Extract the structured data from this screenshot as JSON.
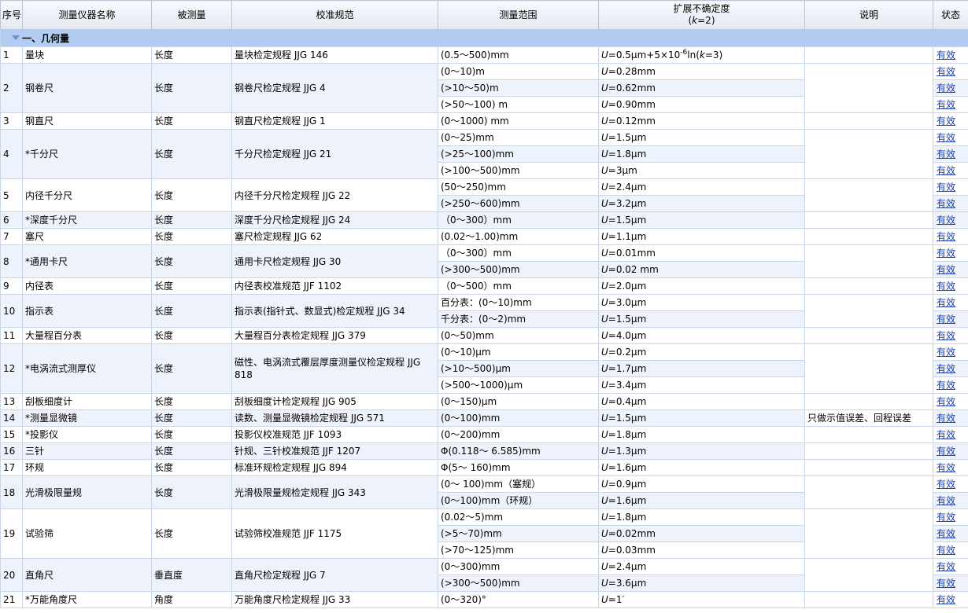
{
  "header": {
    "col_no": "序号",
    "col_name": "测量仪器名称",
    "col_measurand": "被测量",
    "col_spec": "校准规范",
    "col_range": "测量范围",
    "col_uncert_line1": "扩展不确定度",
    "col_uncert_line2_pre": "(",
    "col_uncert_k": "k",
    "col_uncert_line2_post": "=2)",
    "col_note": "说明",
    "col_status": "状态"
  },
  "group": {
    "label": "一、几何量"
  },
  "status_label": "有效",
  "uncertainty_symbol": "U",
  "rows": [
    {
      "no": "1",
      "name": "量块",
      "measurand": "长度",
      "spec": "量块检定规程 JJG 146",
      "note": "",
      "subs": [
        {
          "range": "(0.5～500)mm",
          "u_pre": "=0.5µm+5×10",
          "u_exp": "-6",
          "u_mid": "ln(",
          "u_k": "k",
          "u_post": "=3)"
        }
      ]
    },
    {
      "no": "2",
      "name": "钢卷尺",
      "measurand": "长度",
      "spec": "钢卷尺检定规程 JJG 4",
      "note": "",
      "subs": [
        {
          "range": "(0～10)m",
          "u": "=0.28mm"
        },
        {
          "range": "(>10～50)m",
          "u": "=0.62mm"
        },
        {
          "range": "(>50～100) m",
          "u": "=0.90mm"
        }
      ]
    },
    {
      "no": "3",
      "name": "钢直尺",
      "measurand": "长度",
      "spec": "钢直尺检定规程 JJG 1",
      "note": "",
      "subs": [
        {
          "range": "(0～1000) mm",
          "u": "=0.12mm"
        }
      ]
    },
    {
      "no": "4",
      "name": "*千分尺",
      "measurand": "长度",
      "spec": "千分尺检定规程 JJG 21",
      "note": "",
      "subs": [
        {
          "range": "(0～25)mm",
          "u": "=1.5µm"
        },
        {
          "range": "(>25～100)mm",
          "u": "=1.8µm"
        },
        {
          "range": "(>100～500)mm",
          "u": "=3µm"
        }
      ]
    },
    {
      "no": "5",
      "name": "内径千分尺",
      "measurand": "长度",
      "spec": "内径千分尺检定规程 JJG 22",
      "note": "",
      "subs": [
        {
          "range": "(50～250)mm",
          "u": "=2.4µm"
        },
        {
          "range": "(>250～600)mm",
          "u": "=3.2µm"
        }
      ]
    },
    {
      "no": "6",
      "name": "*深度千分尺",
      "measurand": "长度",
      "spec": "深度千分尺检定规程 JJG 24",
      "note": "",
      "subs": [
        {
          "range": "（0～300）mm",
          "u": "=1.5µm"
        }
      ]
    },
    {
      "no": "7",
      "name": "塞尺",
      "measurand": "长度",
      "spec": "塞尺检定规程 JJG 62",
      "note": "",
      "subs": [
        {
          "range": "(0.02～1.00)mm",
          "u": "=1.1µm"
        }
      ]
    },
    {
      "no": "8",
      "name": "*通用卡尺",
      "measurand": "长度",
      "spec": "通用卡尺检定规程 JJG 30",
      "note": "",
      "subs": [
        {
          "range": "（0～300）mm",
          "u": "=0.01mm"
        },
        {
          "range": "(>300～500)mm",
          "u": "=0.02 mm"
        }
      ]
    },
    {
      "no": "9",
      "name": "内径表",
      "measurand": "长度",
      "spec": "内径表校准规范 JJF 1102",
      "note": "",
      "subs": [
        {
          "range": "（0～500）mm",
          "u": "=2.0µm"
        }
      ]
    },
    {
      "no": "10",
      "name": "指示表",
      "measurand": "长度",
      "spec": "指示表(指针式、数显式)检定规程 JJG 34",
      "note": "",
      "subs": [
        {
          "range": "百分表：(0～10)mm",
          "u": "=3.0µm"
        },
        {
          "range": "千分表：(0～2)mm",
          "u": "=1.5µm"
        }
      ]
    },
    {
      "no": "11",
      "name": "大量程百分表",
      "measurand": "长度",
      "spec": "大量程百分表检定规程 JJG 379",
      "note": "",
      "subs": [
        {
          "range": "(0～50)mm",
          "u": "=4.0µm"
        }
      ]
    },
    {
      "no": "12",
      "name": "*电涡流式测厚仪",
      "measurand": "长度",
      "spec": "磁性、电涡流式覆层厚度测量仪检定规程 JJG 818",
      "note": "",
      "subs": [
        {
          "range": "(0～10)µm",
          "u": "=0.2µm"
        },
        {
          "range": "(>10～500)µm",
          "u": "=1.7µm"
        },
        {
          "range": "(>500～1000)µm",
          "u": "=3.4µm"
        }
      ]
    },
    {
      "no": "13",
      "name": "刮板细度计",
      "measurand": "长度",
      "spec": "刮板细度计检定规程 JJG 905",
      "note": "",
      "subs": [
        {
          "range": "(0～150)µm",
          "u": "=0.4µm"
        }
      ]
    },
    {
      "no": "14",
      "name": "*测量显微镜",
      "measurand": "长度",
      "spec": "读数、测量显微镜检定规程 JJG 571",
      "note": "只做示值误差、回程误差",
      "subs": [
        {
          "range": "(0～100)mm",
          "u": "=1.5µm"
        }
      ]
    },
    {
      "no": "15",
      "name": "*投影仪",
      "measurand": "长度",
      "spec": "投影仪校准规范 JJF 1093",
      "note": "",
      "subs": [
        {
          "range": "(0～200)mm",
          "u": "=1.8µm"
        }
      ]
    },
    {
      "no": "16",
      "name": "三针",
      "measurand": "长度",
      "spec": "针规、三针校准规范 JJF 1207",
      "note": "",
      "subs": [
        {
          "range": "Φ(0.118～ 6.585)mm",
          "u": "=1.3µm"
        }
      ]
    },
    {
      "no": "17",
      "name": "环规",
      "measurand": "长度",
      "spec": "标准环规检定规程 JJG 894",
      "note": "",
      "subs": [
        {
          "range": "Φ(5～ 160)mm",
          "u": "=1.6µm"
        }
      ]
    },
    {
      "no": "18",
      "name": "光滑极限量规",
      "measurand": "长度",
      "spec": "光滑极限量规检定规程 JJG 343",
      "note": "",
      "subs": [
        {
          "range": "(0～ 100)mm（塞规）",
          "u": "=0.9µm"
        },
        {
          "range": "(0～100)mm（环规）",
          "u": "=1.6µm"
        }
      ]
    },
    {
      "no": "19",
      "name": "试验筛",
      "measurand": "长度",
      "spec": "试验筛校准规范 JJF 1175",
      "note": "",
      "subs": [
        {
          "range": "(0.02～5)mm",
          "u": "=1.8µm"
        },
        {
          "range": "(>5～70)mm",
          "u": "=0.02mm"
        },
        {
          "range": "(>70～125)mm",
          "u": "=0.03mm"
        }
      ]
    },
    {
      "no": "20",
      "name": "直角尺",
      "measurand": "垂直度",
      "spec": "直角尺检定规程 JJG 7",
      "note": "",
      "subs": [
        {
          "range": "(0～300)mm",
          "u": "=2.4µm"
        },
        {
          "range": "(>300～500)mm",
          "u": "=3.6µm"
        }
      ]
    },
    {
      "no": "21",
      "name": "*万能角度尺",
      "measurand": "角度",
      "spec": "万能角度尺检定规程 JJG 33",
      "note": "",
      "subs": [
        {
          "range": "(0～320)°",
          "u": "=1′"
        }
      ]
    }
  ]
}
